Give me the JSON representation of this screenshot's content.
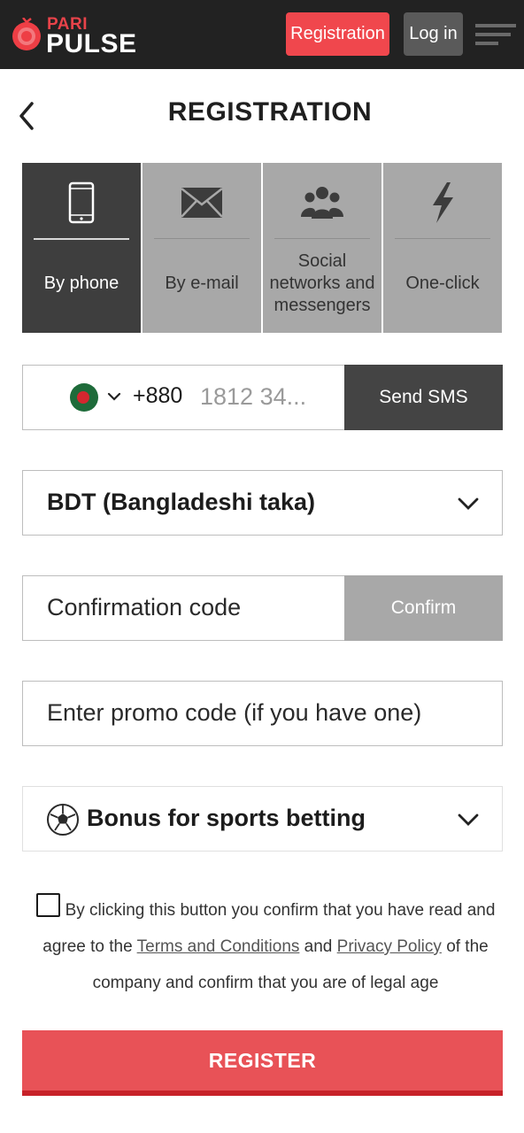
{
  "header": {
    "logo_top": "PARI",
    "logo_bottom": "PULSE",
    "registration_label": "Registration",
    "login_label": "Log in",
    "menu_icon": "hamburger-menu-icon"
  },
  "page": {
    "back_icon": "chevron-left-icon",
    "title": "REGISTRATION"
  },
  "tabs": [
    {
      "label": "By phone",
      "icon": "smartphone-icon",
      "active": true
    },
    {
      "label": "By e-mail",
      "icon": "envelope-icon",
      "active": false
    },
    {
      "label": "Social networks and messengers",
      "icon": "users-icon",
      "active": false
    },
    {
      "label": "One-click",
      "icon": "lightning-icon",
      "active": false
    }
  ],
  "phone": {
    "country_flag": "bangladesh-flag-icon",
    "code": "+880",
    "placeholder": "1812 34...",
    "send_sms_label": "Send SMS"
  },
  "currency": {
    "selected": "BDT (Bangladeshi taka)"
  },
  "confirmation": {
    "placeholder": "Confirmation code",
    "confirm_label": "Confirm"
  },
  "promo": {
    "placeholder": "Enter promo code (if you have one)"
  },
  "bonus": {
    "selected": "Bonus for sports betting",
    "icon": "soccer-ball-icon"
  },
  "terms": {
    "checked": false,
    "text_before": "By clicking this button you confirm that you have read and agree to the",
    "terms_link": "Terms and Conditions",
    "and_text": "and",
    "privacy_link": "Privacy Policy",
    "text_after": "of the company and confirm that you are of legal age"
  },
  "register_label": "REGISTER",
  "colors": {
    "header_bg": "#222222",
    "accent_red": "#f0474d",
    "active_tab": "#3e3e3e",
    "inactive_tab": "#a8a8a8"
  }
}
